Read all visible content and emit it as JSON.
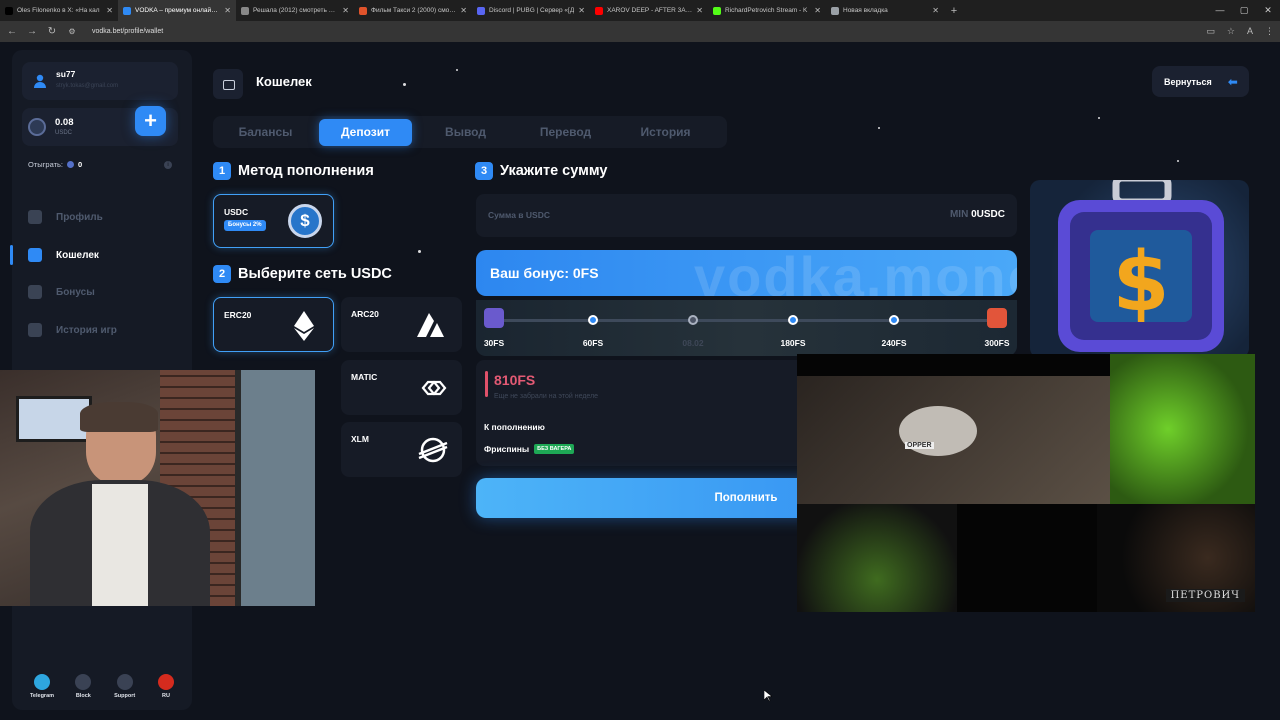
{
  "browser": {
    "tabs": [
      {
        "title": "Oles Filonenko в X: «На кал",
        "fav": "#000000",
        "active": false
      },
      {
        "title": "VODKA – премиум онлайн-ка",
        "fav": "#2f8af5",
        "active": true
      },
      {
        "title": "Решала (2012) смотреть онл",
        "fav": "#888888",
        "active": false
      },
      {
        "title": "Фильм Такси 2 (2000) смотре",
        "fav": "#e0532b",
        "active": false
      },
      {
        "title": "Discord | PUBG | Сервер «[Д",
        "fav": "#5865f2",
        "active": false
      },
      {
        "title": "XAROV DEEP - AFTER 3AM (Оч",
        "fav": "#ff0000",
        "active": false
      },
      {
        "title": "RichardPetrovich Stream - K",
        "fav": "#53fc18",
        "active": false
      },
      {
        "title": "Новая вкладка",
        "fav": "#9aa0a6",
        "active": false
      }
    ],
    "url": "vodka.bet/profile/wallet"
  },
  "sidebar": {
    "username": "su77",
    "email": "stryk.tokas@gmail.com",
    "balance": "0.08",
    "currency": "USDC",
    "wager_label": "Отыграть:",
    "wager_value": "0",
    "nav": [
      {
        "label": "Профиль",
        "icon": "user-icon",
        "active": false
      },
      {
        "label": "Кошелек",
        "icon": "wallet-icon",
        "active": true
      },
      {
        "label": "Бонусы",
        "icon": "gift-icon",
        "active": false
      },
      {
        "label": "История игр",
        "icon": "history-icon",
        "active": false
      }
    ],
    "bottom": [
      {
        "label": "Telegram",
        "icon": "telegram-icon",
        "color": "#2ea6df"
      },
      {
        "label": "Block",
        "icon": "lock-icon",
        "color": "#3a4254"
      },
      {
        "label": "Support",
        "icon": "headset-icon",
        "color": "#3a4254"
      },
      {
        "label": "RU",
        "icon": "ru-flag-icon",
        "color": "#d52b1e"
      }
    ]
  },
  "header": {
    "title": "Кошелек",
    "back": "Вернуться"
  },
  "tabs": [
    "Балансы",
    "Депозит",
    "Вывод",
    "Перевод",
    "История"
  ],
  "active_tab": "Депозит",
  "method": {
    "num": "1",
    "title": "Метод пополнения",
    "selected_label": "USDC",
    "selected_bonus": "Бонусы 2%"
  },
  "network": {
    "num": "2",
    "title": "Выберите сеть USDC",
    "options": [
      "ERC20",
      "ARC20",
      "MATIC",
      "XLM"
    ],
    "selected": "ERC20"
  },
  "amount": {
    "num": "3",
    "title": "Укажите сумму",
    "placeholder": "Сумма в USDC",
    "min_label": "MIN",
    "min_value": "0USDC"
  },
  "bonus": {
    "text": "Ваш бонус: 0FS",
    "watermark": "vodka.money",
    "steps": [
      {
        "label": "30FS",
        "type": "gift",
        "dim": false
      },
      {
        "label": "60FS",
        "type": "node",
        "dim": false
      },
      {
        "label": "08.02",
        "type": "node",
        "dim": true
      },
      {
        "label": "180FS",
        "type": "node",
        "dim": false
      },
      {
        "label": "240FS",
        "type": "node",
        "dim": false
      },
      {
        "label": "300FS",
        "type": "gift",
        "dim": false
      }
    ]
  },
  "freespins": {
    "value": "810FS",
    "subtitle": "Еще не забрали на этой неделе",
    "row1": "К пополнению",
    "row2": "Фриспины",
    "badge": "БЕЗ ВАГЕРА"
  },
  "deposit_button": "Пополнить",
  "stream_overlay": {
    "watermark": "ПЕТРОВИЧ",
    "label_on_jar": "OPPER"
  }
}
